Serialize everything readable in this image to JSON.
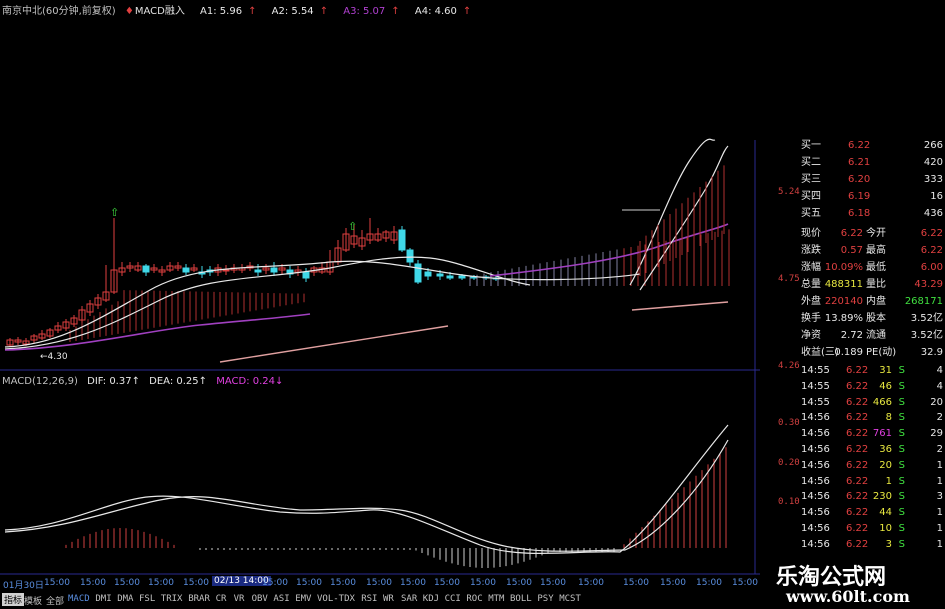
{
  "header": {
    "title": "南京中北(60分钟,前复权)",
    "indicator": "MACD融入",
    "a1_label": "A1: 5.96",
    "a2_label": "A2: 5.54",
    "a3_label": "A3: 5.07",
    "a4_label": "A4: 4.60",
    "arrow": "↑"
  },
  "price_axis": [
    "5.24",
    "4.75",
    "4.26"
  ],
  "low_marker": "←4.30",
  "macd_header": {
    "name": "MACD(12,26,9)",
    "dif": "DIF: 0.37↑",
    "dea": "DEA: 0.25↑",
    "macd": "MACD: 0.24↓"
  },
  "macd_axis": [
    "0.30",
    "0.20",
    "0.10"
  ],
  "x_axis": [
    "01月30日",
    "15:00",
    "15:00",
    "15:00",
    "15:00",
    "15:00",
    "15:00",
    "15:00",
    "02/13 14:00",
    "15:00",
    "15:00",
    "15:00",
    "15:00",
    "15:00",
    "15:00",
    "15:00",
    "15:00",
    "15:00",
    "15:00",
    "15:00",
    "15:00",
    "15:00",
    "15:00",
    "15:00",
    "15:00"
  ],
  "quote_panel": {
    "bids": [
      {
        "label": "买一",
        "price": "6.22",
        "vol": "266"
      },
      {
        "label": "买二",
        "price": "6.21",
        "vol": "420"
      },
      {
        "label": "买三",
        "price": "6.20",
        "vol": "333"
      },
      {
        "label": "买四",
        "price": "6.19",
        "vol": "16"
      },
      {
        "label": "买五",
        "price": "6.18",
        "vol": "436"
      }
    ],
    "stats": [
      {
        "l1": "现价",
        "v1": "6.22",
        "l2": "今开",
        "v2": "6.22"
      },
      {
        "l1": "涨跌",
        "v1": "0.57",
        "l2": "最高",
        "v2": "6.22"
      },
      {
        "l1": "涨幅",
        "v1": "10.09%",
        "l2": "最低",
        "v2": "6.00"
      },
      {
        "l1": "总量",
        "v1": "488311",
        "l2": "量比",
        "v2": "43.29"
      },
      {
        "l1": "外盘",
        "v1": "220140",
        "l2": "内盘",
        "v2": "268171"
      },
      {
        "l1": "换手",
        "v1": "13.89%",
        "l2": "股本",
        "v2": "3.52亿"
      },
      {
        "l1": "净资",
        "v1": "2.72",
        "l2": "流通",
        "v2": "3.52亿"
      },
      {
        "l1": "收益(三)",
        "v1": "0.189",
        "l2": "PE(动)",
        "v2": "32.9"
      }
    ],
    "ticks": [
      {
        "time": "14:55",
        "price": "6.22",
        "vol": "31",
        "side": "S",
        "n": "4"
      },
      {
        "time": "14:55",
        "price": "6.22",
        "vol": "46",
        "side": "S",
        "n": "4"
      },
      {
        "time": "14:55",
        "price": "6.22",
        "vol": "466",
        "side": "S",
        "n": "20"
      },
      {
        "time": "14:56",
        "price": "6.22",
        "vol": "8",
        "side": "S",
        "n": "2"
      },
      {
        "time": "14:56",
        "price": "6.22",
        "vol": "761",
        "side": "S",
        "n": "29"
      },
      {
        "time": "14:56",
        "price": "6.22",
        "vol": "36",
        "side": "S",
        "n": "2"
      },
      {
        "time": "14:56",
        "price": "6.22",
        "vol": "20",
        "side": "S",
        "n": "1"
      },
      {
        "time": "14:56",
        "price": "6.22",
        "vol": "1",
        "side": "S",
        "n": "1"
      },
      {
        "time": "14:56",
        "price": "6.22",
        "vol": "230",
        "side": "S",
        "n": "3"
      },
      {
        "time": "14:56",
        "price": "6.22",
        "vol": "44",
        "side": "S",
        "n": "1"
      },
      {
        "time": "14:56",
        "price": "6.22",
        "vol": "10",
        "side": "S",
        "n": "1"
      },
      {
        "time": "14:56",
        "price": "6.22",
        "vol": "3",
        "side": "S",
        "n": "1"
      }
    ]
  },
  "indicator_bar": [
    "指标",
    "模板",
    "全部",
    "MACD",
    "DMI",
    "DMA",
    "FSL",
    "TRIX",
    "BRAR",
    "CR",
    "VR",
    "OBV",
    "ASI",
    "EMV",
    "VOL-TDX",
    "RSI",
    "WR",
    "SAR",
    "KDJ",
    "CCI",
    "ROC",
    "MTM",
    "BOLL",
    "PSY",
    "MCST"
  ],
  "watermark": {
    "title": "乐淘公式网",
    "url": "www.60lt.com"
  },
  "colors": {
    "up": "#e04040",
    "down": "#40d8e8",
    "ma_white": "#e8e8e8",
    "ma_purple": "#a040c0",
    "grid": "#3030a0",
    "label_white": "#e8e8e8",
    "label_yellow": "#e8e840",
    "label_magenta": "#e040e0",
    "label_red": "#e04040",
    "label_cyan": "#40e0e0"
  }
}
